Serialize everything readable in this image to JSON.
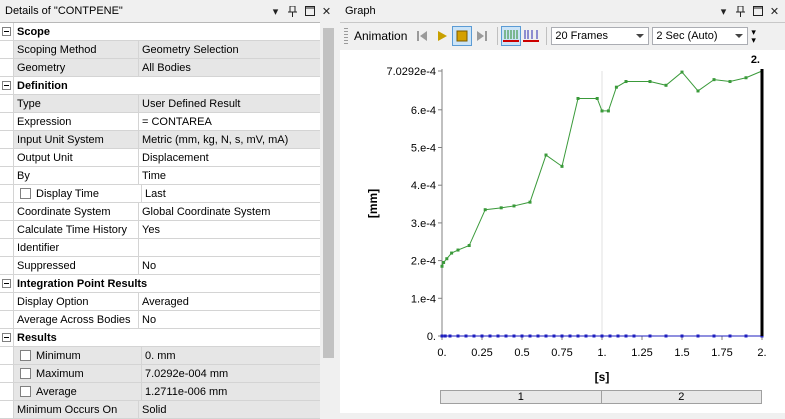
{
  "details": {
    "title": "Details of \"CONTPENE\"",
    "rows": [
      {
        "type": "cat",
        "label": "Scope"
      },
      {
        "type": "prop",
        "label": "Scoping Method",
        "value": "Geometry Selection",
        "grey": true
      },
      {
        "type": "prop",
        "label": "Geometry",
        "value": "All Bodies",
        "grey": true
      },
      {
        "type": "cat",
        "label": "Definition"
      },
      {
        "type": "prop",
        "label": "Type",
        "value": "User Defined Result",
        "grey": true
      },
      {
        "type": "prop",
        "label": "Expression",
        "value": "= CONTAREA"
      },
      {
        "type": "prop",
        "label": "Input Unit System",
        "value": "Metric (mm, kg, N, s, mV, mA)",
        "grey": true
      },
      {
        "type": "prop",
        "label": "Output Unit",
        "value": "Displacement"
      },
      {
        "type": "prop",
        "label": "By",
        "value": "Time"
      },
      {
        "type": "prop",
        "label": "Display Time",
        "value": "Last",
        "check": true
      },
      {
        "type": "prop",
        "label": "Coordinate System",
        "value": "Global Coordinate System"
      },
      {
        "type": "prop",
        "label": "Calculate Time History",
        "value": "Yes"
      },
      {
        "type": "prop",
        "label": "Identifier",
        "value": ""
      },
      {
        "type": "prop",
        "label": "Suppressed",
        "value": "No"
      },
      {
        "type": "cat",
        "label": "Integration Point Results"
      },
      {
        "type": "prop",
        "label": "Display Option",
        "value": "Averaged"
      },
      {
        "type": "prop",
        "label": "Average Across Bodies",
        "value": "No"
      },
      {
        "type": "cat",
        "label": "Results"
      },
      {
        "type": "prop",
        "label": "Minimum",
        "value": "0. mm",
        "check": true,
        "grey": true
      },
      {
        "type": "prop",
        "label": "Maximum",
        "value": "7.0292e-004 mm",
        "check": true,
        "grey": true
      },
      {
        "type": "prop",
        "label": "Average",
        "value": "1.2711e-006 mm",
        "check": true,
        "grey": true
      },
      {
        "type": "prop",
        "label": "Minimum Occurs On",
        "value": "Solid",
        "grey": true
      }
    ]
  },
  "graph": {
    "title": "Graph",
    "animation_label": "Animation",
    "frames": "20 Frames",
    "duration": "2 Sec (Auto)",
    "timeline": [
      "1",
      "2"
    ]
  },
  "colors": {
    "series_top": "#3a9a3a",
    "series_bottom": "#1f1fbf",
    "cursor": "#000000"
  },
  "chart_data": {
    "type": "line",
    "xlabel": "[s]",
    "ylabel": "[mm]",
    "xlim": [
      0,
      2
    ],
    "ylim": [
      0,
      0.00070292
    ],
    "xticks": [
      0,
      0.25,
      0.5,
      0.75,
      1,
      1.25,
      1.5,
      1.75,
      2
    ],
    "xtick_labels": [
      "0.",
      "0.25",
      "0.5",
      "0.75",
      "1.",
      "1.25",
      "1.5",
      "1.75",
      "2."
    ],
    "yticks": [
      0,
      0.0001,
      0.0002,
      0.0003,
      0.0004,
      0.0005,
      0.0006,
      0.00070292
    ],
    "ytick_labels": [
      "0.",
      "1.e-4",
      "2.e-4",
      "3.e-4",
      "4.e-4",
      "5.e-4",
      "6.e-4",
      "7.0292e-4"
    ],
    "cursor_x": 2,
    "cursor_label": "2.",
    "series": [
      {
        "color": "#3a9a3a",
        "x": [
          0,
          0.01,
          0.03,
          0.06,
          0.1,
          0.17,
          0.27,
          0.37,
          0.45,
          0.55,
          0.65,
          0.75,
          0.85,
          0.97,
          1.0,
          1.04,
          1.09,
          1.15,
          1.3,
          1.4,
          1.5,
          1.6,
          1.7,
          1.8,
          1.9,
          2.0
        ],
        "y": [
          0.000185,
          0.000195,
          0.000205,
          0.00022,
          0.000228,
          0.00024,
          0.000335,
          0.00034,
          0.000345,
          0.000355,
          0.00048,
          0.00045,
          0.00063,
          0.00063,
          0.000597,
          0.000597,
          0.00066,
          0.000675,
          0.000675,
          0.000665,
          0.0007,
          0.00065,
          0.00068,
          0.000675,
          0.000685,
          0.00070292
        ]
      },
      {
        "color": "#1f1fbf",
        "x": [
          0,
          0.02,
          0.05,
          0.1,
          0.15,
          0.2,
          0.25,
          0.3,
          0.35,
          0.4,
          0.45,
          0.5,
          0.55,
          0.6,
          0.65,
          0.7,
          0.75,
          0.8,
          0.85,
          0.9,
          0.95,
          1.0,
          1.05,
          1.1,
          1.15,
          1.2,
          1.3,
          1.4,
          1.5,
          1.6,
          1.7,
          1.8,
          1.9,
          2.0
        ],
        "y": [
          0,
          0,
          0,
          0,
          0,
          0,
          0,
          0,
          0,
          0,
          0,
          0,
          0,
          0,
          0,
          0,
          0,
          0,
          0,
          0,
          0,
          0,
          0,
          0,
          0,
          0,
          0,
          0,
          0,
          0,
          0,
          0,
          0,
          0
        ]
      }
    ]
  }
}
